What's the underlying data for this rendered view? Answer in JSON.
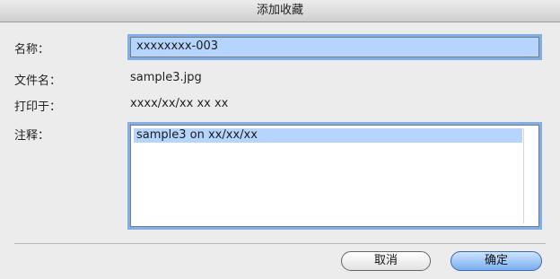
{
  "window": {
    "title": "添加收藏"
  },
  "form": {
    "name_label": "名称：",
    "name_value": "xxxxxxxx-003",
    "filename_label": "文件名：",
    "filename_value": "sample3.jpg",
    "printed_label": "打印于：",
    "printed_value": "xxxx/xx/xx  xx xx",
    "notes_label": "注释：",
    "notes_value": "sample3 on xx/xx/xx"
  },
  "buttons": {
    "cancel": "取消",
    "ok": "确定"
  },
  "colors": {
    "focus_ring": "#7faee8",
    "selection": "#b5d5ff",
    "default_button": "#79aef0"
  }
}
